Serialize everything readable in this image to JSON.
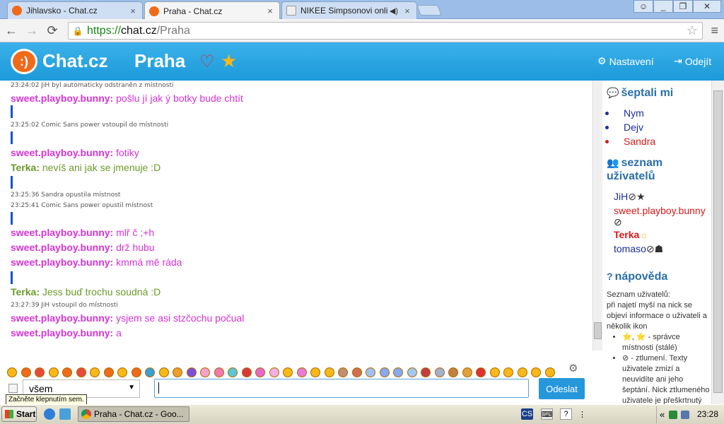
{
  "browser": {
    "tabs": [
      {
        "title": "Jihlavsko - Chat.cz",
        "close": "×"
      },
      {
        "title": "Praha - Chat.cz",
        "close": "×"
      },
      {
        "title": "NIKEE Simpsonovi online",
        "close": "×"
      }
    ],
    "url": {
      "scheme": "https://",
      "host": "chat.cz",
      "path": "/Praha"
    },
    "icons": {
      "back": "←",
      "forward": "→",
      "reload": "⟳",
      "star": "☆",
      "menu": "≡"
    }
  },
  "site": {
    "logo_text": "Chat.cz",
    "logo_glyph": ":)",
    "room": "Praha",
    "settings": "Nastavení",
    "logout": "Odejít",
    "colors": {
      "header": "#1d9ad9",
      "logo": "#f06a1a",
      "heart": "#d92b3a",
      "star": "#f7b818"
    }
  },
  "chat": {
    "lines": [
      {
        "kind": "sys",
        "text": "23:24:02 JiH byl automaticky odstraněn z místnosti"
      },
      {
        "kind": "msg",
        "color": "pink",
        "nick": "sweet.playboy.bunny:",
        "text": "pošlu jí jak ý botky bude chtít"
      },
      {
        "kind": "bar"
      },
      {
        "kind": "sys",
        "text": "23:25:02 Comic Sans power vstoupil do místnosti"
      },
      {
        "kind": "bar"
      },
      {
        "kind": "msg",
        "color": "pink",
        "nick": "sweet.playboy.bunny:",
        "text": "fotiky"
      },
      {
        "kind": "msg",
        "color": "green",
        "nick": "Terka:",
        "text": "nevíš ani jak se jmenuje :D"
      },
      {
        "kind": "bar"
      },
      {
        "kind": "sys",
        "text": "23:25:36 Sandra opustila místnost"
      },
      {
        "kind": "sys",
        "text": "23:25:41 Comic Sans power opustil místnost"
      },
      {
        "kind": "bar"
      },
      {
        "kind": "msg",
        "color": "pink",
        "nick": "sweet.playboy.bunny:",
        "text": "mlř č ;+h"
      },
      {
        "kind": "msg",
        "color": "pink",
        "nick": "sweet.playboy.bunny:",
        "text": "drž hubu"
      },
      {
        "kind": "msg",
        "color": "pink",
        "nick": "sweet.playboy.bunny:",
        "text": "kmmá mě ráda"
      },
      {
        "kind": "bar"
      },
      {
        "kind": "msg",
        "color": "green",
        "nick": "Terka:",
        "text": "Jess buď trochu soudná :D"
      },
      {
        "kind": "sys",
        "text": "23:27:39 JiH vstoupil do místnosti"
      },
      {
        "kind": "msg",
        "color": "pink",
        "nick": "sweet.playboy.bunny:",
        "text": "ysjem se asi stzčochu počual"
      },
      {
        "kind": "msg",
        "color": "pink",
        "nick": "sweet.playboy.bunny:",
        "text": "a"
      }
    ]
  },
  "sidebar": {
    "whispered_title": "šeptali mi",
    "whispered": [
      {
        "name": "Nym",
        "color": "blue"
      },
      {
        "name": "Dejv",
        "color": "blue"
      },
      {
        "name": "Sandra",
        "color": "red"
      }
    ],
    "users_title_1": "seznam",
    "users_title_2": "uživatelů",
    "users": [
      {
        "name": "JiH",
        "color": "#1a2d9c",
        "marks": "⊘★"
      },
      {
        "name": "sweet.playboy.bunny",
        "color": "#d81818",
        "marks": ""
      },
      {
        "name": "⊘",
        "color": "#222",
        "marks": ""
      },
      {
        "name": "Terka",
        "color": "#d81818",
        "marks": "☼",
        "bold": true
      },
      {
        "name": "tomaso",
        "color": "#1a2d9c",
        "marks": "⊘☗"
      }
    ],
    "help_title": "nápověda",
    "help_intro_1": "Seznam uživatelů:",
    "help_intro_2": "při najetí myší na nick se objeví informace o uživateli a několik ikon",
    "help_items": [
      "⭐, ⭐ - správce místnosti (stálé)",
      "⊘ - ztlumení. Texty uživatele zmizí a neuvidíte ani jeho šeptání. Nick ztlumeného uživatele je přeškrtnutý"
    ]
  },
  "input": {
    "target": "všem",
    "send": "Odeslat",
    "tooltip": "Začněte klepnutím sem."
  },
  "taskbar": {
    "start": "Start",
    "task": "Praha - Chat.cz - Goo...",
    "lang": "CS",
    "clock": "23:28",
    "tray_arrows": "«"
  }
}
